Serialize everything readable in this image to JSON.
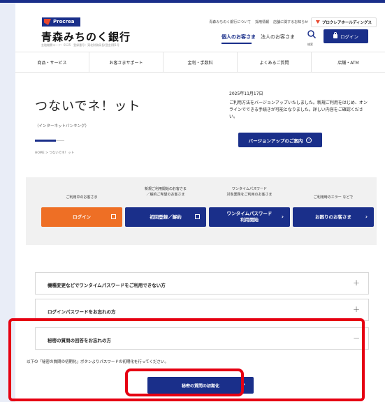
{
  "colors": {
    "primary": "#1a2f8a",
    "accent": "#e8482e",
    "orange": "#ee6f25",
    "highlight": "#e60012"
  },
  "header": {
    "logo_text": "Procrea",
    "bank_name": "青森みちのく銀行",
    "bank_sub": "金融機関コード：0125　登録番号：東北財務局長(登金)第1号",
    "top_links": [
      "青森みちのく銀行について",
      "採用情報",
      "店舗に関するお知らせ"
    ],
    "group_link": "プロクレアホールディングス",
    "personal": "個人のお客さま",
    "corporate": "法人のお客さま",
    "search_label": "検索",
    "login": "ログイン"
  },
  "gnav": [
    "商品・サービス",
    "お客さまサポート",
    "金利・手数料",
    "よくあるご質問",
    "店舗・ATM"
  ],
  "main": {
    "title": "つないでネ！ット",
    "subtitle": "（インターネットバンキング）",
    "breadcrumb": "HOME > つないでネ！ット"
  },
  "notice": {
    "date": "2025年11月17日",
    "text": "ご利用方法をバージョンアップいたしました。新規ご利用をはじめ、オンラインでできる手続きが可能となりました。詳しい内容をご確認ください。",
    "button": "バージョンアップのご案内"
  },
  "login_panel": [
    {
      "desc": "ご利用中のお客さま",
      "button": "ログイン"
    },
    {
      "desc": "新規ご利用開始のお客さま\n／解約ご希望のお客さま",
      "button": "初回登録／解約"
    },
    {
      "desc": "ワンタイムパスワード\n対象業務をご利用のお客さま",
      "button": "ワンタイムパスワード\n利用開始"
    },
    {
      "desc": "ご利用時のエラー などで",
      "button": "お困りのお客さま"
    }
  ],
  "accordion": [
    {
      "title": "機種変更などでワンタイムパスワードをご利用できない方",
      "icon": "+"
    },
    {
      "title": "ログインパスワードをお忘れの方",
      "icon": "+"
    },
    {
      "title": "秘密の質問の回答をお忘れの方",
      "icon": "−"
    }
  ],
  "accordion_open_body": "以下の「秘密の質問の初期化」ボタンよりパスワードの初期化を行ってください。",
  "init_button": "秘密の質問の初期化"
}
